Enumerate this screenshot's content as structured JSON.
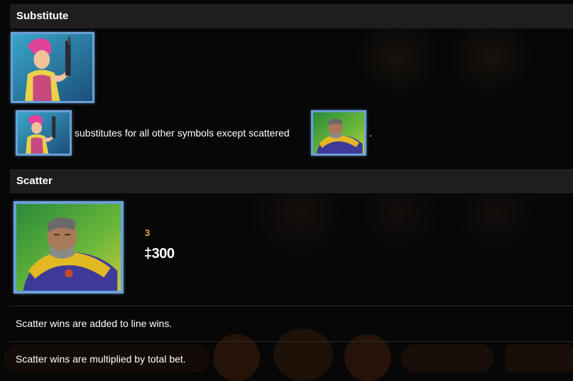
{
  "sections": {
    "substitute": {
      "title": "Substitute",
      "description": "substitutes for all other symbols except scattered",
      "trailing": "."
    },
    "scatter": {
      "title": "Scatter",
      "pay_count": "3",
      "pay_amount": "‡300"
    }
  },
  "rules": [
    "Scatter wins are added to line wins.",
    "Scatter wins are multiplied by total bet."
  ],
  "symbols": {
    "substitute_icon": "woman-with-gun-wild-symbol",
    "scatter_icon": "armored-soldier-scatter-symbol"
  },
  "colors": {
    "header_bg": "#1e1e1e",
    "accent_orange": "#f2a33a",
    "frame_blue": "#6aa0d8",
    "frame_gold": "#d6b648"
  }
}
